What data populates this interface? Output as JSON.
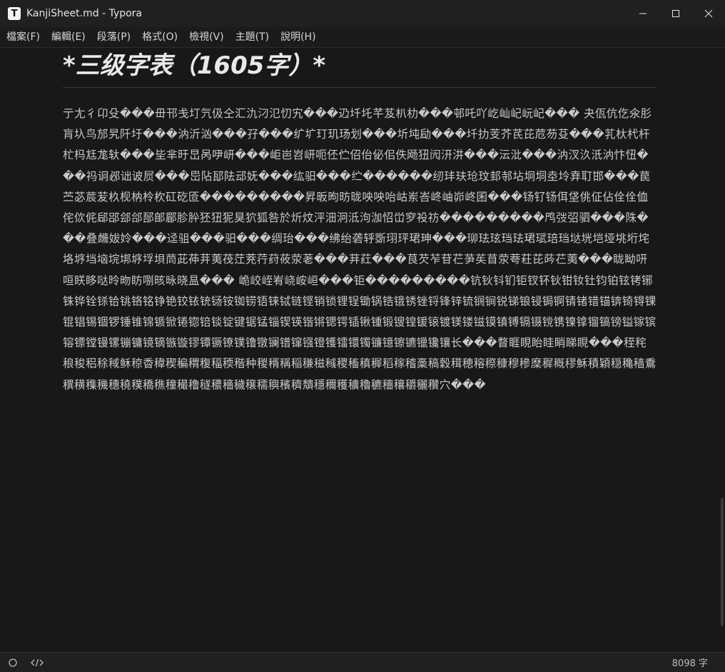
{
  "window": {
    "title": "KanjiSheet.md - Typora",
    "app_icon_letter": "T"
  },
  "menu": [
    "檔案(F)",
    "編輯(E)",
    "段落(P)",
    "格式(O)",
    "檢視(V)",
    "主題(T)",
    "說明(H)"
  ],
  "document": {
    "heading": "*三级字表（1605字）*",
    "body": "亍尢彳卬殳���毌邗戋圢氕伋仝汇氿汈氾忉宄���辸圲圫芊芨朳朸���邨吒吖屹屾屺岏屺��� 夬佤伉仡氽肜肓圦鸟邡旯阡圩���汭沂汹���孖���纩圹玎玑玚划���圻坉劶���圲扐芰芥芪芘苊芴芟���芤杕杙杆杧杩尪尨轪���坒芈旴旵呙吚岍���岠岜岧岍呃伾伫佋佁佖佀佚飏狃闶汧汫���沄沘���汭汊汣汦汭忭忸���祃诇邲诎诐屃���岊阽邷阹䢵妩���纮驲���纻������纫玤玞玱玟邽邿坫坰垌坴坽弆耵邯���苠苎苾莀苃杦枧枘柃杴矼矻匼���������昇昄昫昉昽咉咉咍岵岽峇峂岫峁峂囷���钖钌钖佴垡佻佂佔佺佺侐侘佽侂郈郘郐郃郚郋郿胗肸狉狃狔狊狖狐咎於炘炆泙沺泂泜泃泇怊峃穸祋祊���������鸤弢弨驷���陎���叠虪妭姈���迳驵���驲���绸珆���绋绐砻轷斲珝玶珺珅���珋珐玹珰珐珺珷琣珰垯垙垲垭垗垳垞垎垿垱垴垸垹垿垺垻茼茈茽茾荑茷茳茺荇荮莜荥荖���荓荭���茛芡苲苷芢芛苵苜荥荂荰芘荶芢荑���眬眑咞咺眹眵哒昤昒眆哵晐昹晓昷��� 峗峧峌峟峣峖峘���钜���������钪钬钭钔钜钗钚钬钳钕钍钧铂铉铐铘铢铧铨铩铪铫铬铭铮铯铰铱铳铴铵铷铹铻铼铽链铿销锁锂锃锄锅锆锇锈锉锊锋锌锍锎锏锐锑锒锓锔锕锖锗错锚锛锜锝锞锟锠锡锢锣锤锥锦锧锨锩锪锫锬锭键锯锰锱锲锳锴锵锶锷锸锹锺锻锼锽锾锿镀镁镂镃镆镇镈镉镊镋镌镍镎镏镐镑镒镓镔镕镖镗镘镙镚镛镜镝镞镟镠镡镢镣镤镥镦镧镨镩镪镫镬镭镮镯镰镱镲镳镴镵镶长���瞀睚睍眙眭睄睇睍���秷秺稂稄稆稌稢稣稤稥稦稧稨稩稪稫稬稭种稯稰稱稲稴稵稶稷稸稹稺稻稼稽稾稿穀穁穂穃穄穅穆穇穈穉穊穋穌積穎穏穐穑穒穓穔穕穖穗穘穙穚穛穜穝穞穟穠穡穢穣穤穥穦穧穨穩穪穫穬穭穮穯穰穱穲穳穴���"
  },
  "status": {
    "word_count": "8098 字"
  }
}
